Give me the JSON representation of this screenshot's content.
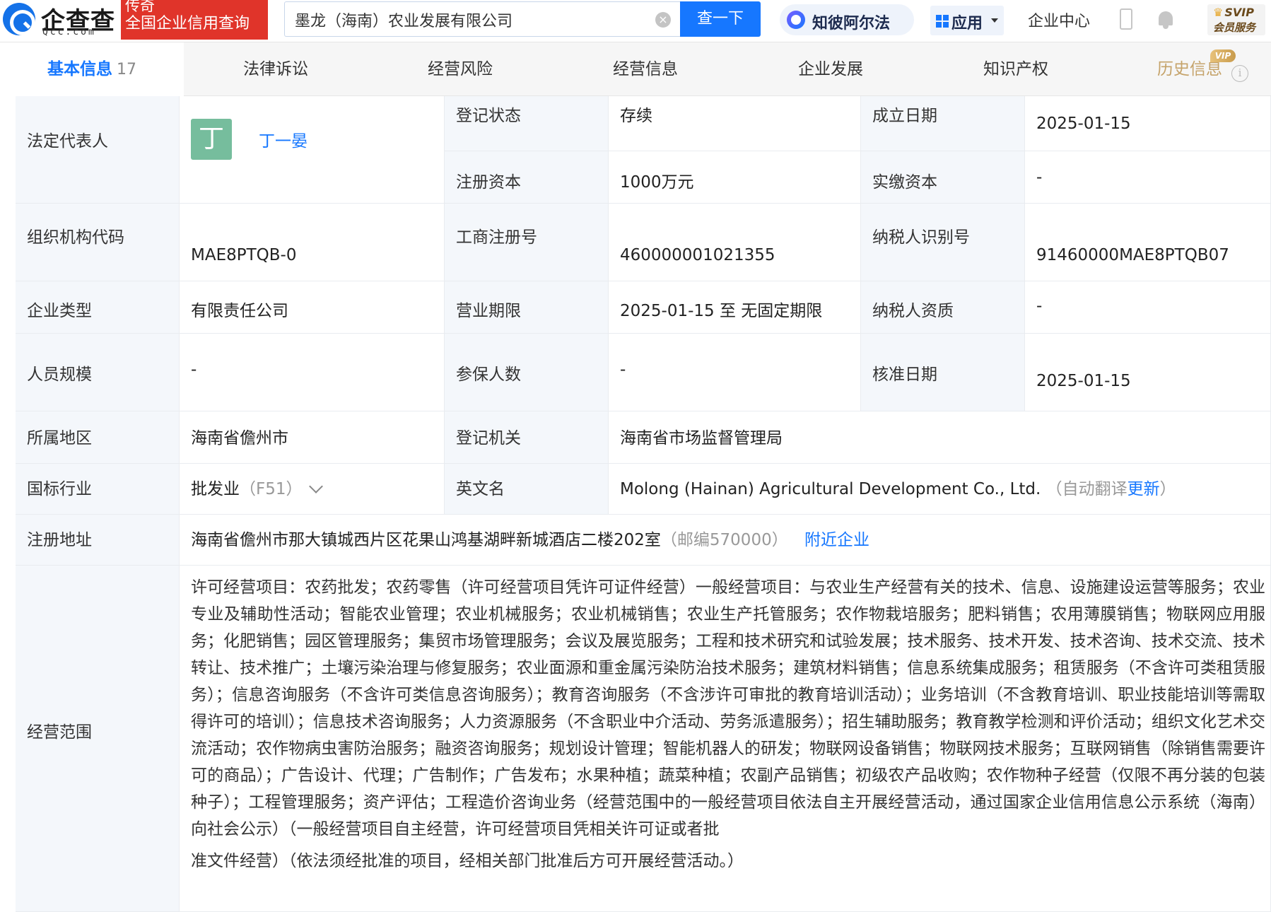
{
  "header": {
    "logo_main": "企查查",
    "logo_sub": "Qcc.com",
    "promo_line1": "传奇",
    "promo_line2": "全国企业信用查询",
    "search_value": "墨龙（海南）农业发展有限公司",
    "clear_icon": "⊗",
    "search_button": "查一下",
    "zhibi_label": "知彼阿尔法",
    "app_label": "应用",
    "corp_center": "企业中心",
    "svip_top": "SVIP",
    "svip_bottom": "会员服务"
  },
  "tabs": [
    {
      "label": "基本信息",
      "count": "17",
      "active": true
    },
    {
      "label": "法律诉讼"
    },
    {
      "label": "经营风险"
    },
    {
      "label": "经营信息"
    },
    {
      "label": "企业发展"
    },
    {
      "label": "知识产权"
    },
    {
      "label": "历史信息",
      "badge": "VIP"
    }
  ],
  "info": {
    "legal_rep_label": "法定代表人",
    "legal_rep_avatar": "丁",
    "legal_rep_name": "丁一晏",
    "reg_status_label": "登记状态",
    "reg_status": "存续",
    "found_date_label": "成立日期",
    "found_date": "2025-01-15",
    "reg_capital_label": "注册资本",
    "reg_capital": "1000万元",
    "paid_capital_label": "实缴资本",
    "paid_capital": "-",
    "org_code_label": "组织机构代码",
    "org_code": "MAE8PTQB-0",
    "biz_reg_no_label": "工商注册号",
    "biz_reg_no": "460000001021355",
    "tax_id_label": "纳税人识别号",
    "tax_id": "91460000MAE8PTQB07",
    "company_type_label": "企业类型",
    "company_type": "有限责任公司",
    "biz_term_label": "营业期限",
    "biz_term": "2025-01-15 至 无固定期限",
    "taxpayer_qual_label": "纳税人资质",
    "taxpayer_qual": "-",
    "staff_size_label": "人员规模",
    "staff_size": "-",
    "insured_label": "参保人数",
    "insured": "-",
    "approval_date_label": "核准日期",
    "approval_date": "2025-01-15",
    "region_label": "所属地区",
    "region": "海南省儋州市",
    "reg_authority_label": "登记机关",
    "reg_authority": "海南省市场监督管理局",
    "industry_label": "国标行业",
    "industry": "批发业",
    "industry_code": "（F51）",
    "en_name_label": "英文名",
    "en_name": "Molong (Hainan) Agricultural Development Co., Ltd.",
    "en_name_note_pre": "（自动翻译",
    "en_name_update": "更新",
    "en_name_note_post": "）",
    "address_label": "注册地址",
    "address": "海南省儋州市那大镇城西片区花果山鸿基湖畔新城酒店二楼202室",
    "postcode": "（邮编570000）",
    "nearby": "附近企业",
    "scope_label": "经营范围",
    "scope_text": "许可经营项目：农药批发；农药零售（许可经营项目凭许可证件经营）一般经营项目：与农业生产经营有关的技术、信息、设施建设运营等服务；农业专业及辅助性活动；智能农业管理；农业机械服务；农业机械销售；农业生产托管服务；农作物栽培服务；肥料销售；农用薄膜销售；物联网应用服务；化肥销售；园区管理服务；集贸市场管理服务；会议及展览服务；工程和技术研究和试验发展；技术服务、技术开发、技术咨询、技术交流、技术转让、技术推广；土壤污染治理与修复服务；农业面源和重金属污染防治技术服务；建筑材料销售；信息系统集成服务；租赁服务（不含许可类租赁服务）；信息咨询服务（不含许可类信息咨询服务）；教育咨询服务（不含涉许可审批的教育培训活动）；业务培训（不含教育培训、职业技能培训等需取得许可的培训）；信息技术咨询服务；人力资源服务（不含职业中介活动、劳务派遣服务）；招生辅助服务；教育教学检测和评价活动；组织文化艺术交流活动；农作物病虫害防治服务；融资咨询服务；规划设计管理；智能机器人的研发；物联网设备销售；物联网技术服务；互联网销售（除销售需要许可的商品）；广告设计、代理；广告制作；广告发布；水果种植；蔬菜种植；农副产品销售；初级农产品收购；农作物种子经营（仅限不再分装的包装种子）；工程管理服务；资产评估；工程造价咨询业务（经营范围中的一般经营项目依法自主开展经营活动，通过国家企业信用信息公示系统（海南）向社会公示）（一般经营项目自主经营，许可经营项目凭相关许可证或者批",
    "scope_tail": "准文件经营）（依法须经批准的项目，经相关部门批准后方可开展经营活动。）"
  }
}
